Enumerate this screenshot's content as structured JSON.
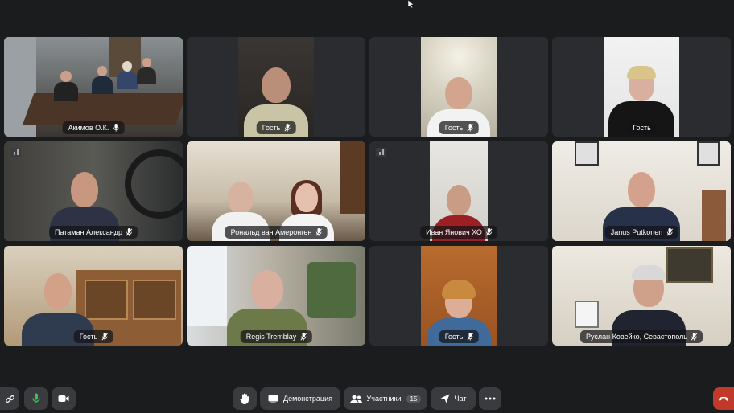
{
  "participants": [
    {
      "name": "Акимов О.К.",
      "mic": "on",
      "active": true,
      "scene": "conference-room"
    },
    {
      "name": "Гость",
      "mic": "off",
      "scene": "bald-man"
    },
    {
      "name": "Гость",
      "mic": "off",
      "scene": "man-white-shirt"
    },
    {
      "name": "Гость",
      "mic": "none",
      "scene": "woman-donbass-shirt"
    },
    {
      "name": "Патаман Александр",
      "mic": "off",
      "scene": "man-in-car"
    },
    {
      "name": "Рональд ван Амеронген",
      "mic": "off",
      "scene": "couple"
    },
    {
      "name": "Иван Янович ХО",
      "mic": "off",
      "scene": "man-red-jacket"
    },
    {
      "name": "Janus Putkonen",
      "mic": "off",
      "scene": "man-suit-office"
    },
    {
      "name": "Гость",
      "mic": "off",
      "scene": "man-glasses-cabinet"
    },
    {
      "name": "Regis Tremblay",
      "mic": "off",
      "scene": "older-man-plaid"
    },
    {
      "name": "Гость",
      "mic": "off",
      "scene": "woman-glasses"
    },
    {
      "name": "Руслан Ковейко, Севастополь",
      "mic": "off",
      "scene": "grey-haired-man"
    }
  ],
  "toolbar": {
    "raise_hand_icon": "hand-icon",
    "demo_label": "Демонстрация",
    "participants_label": "Участники",
    "participants_count": "15",
    "chat_label": "Чат",
    "more_icon": "more-icon",
    "link_icon": "link-icon",
    "mic_icon": "mic-icon",
    "camera_icon": "camera-icon",
    "hangup_icon": "hangup-icon"
  },
  "colors": {
    "background": "#1b1c1e",
    "tile": "#2b2c2f",
    "active_border": "#5fd35f",
    "mic_on": "#3fbf5a",
    "hangup": "#c0392b"
  }
}
